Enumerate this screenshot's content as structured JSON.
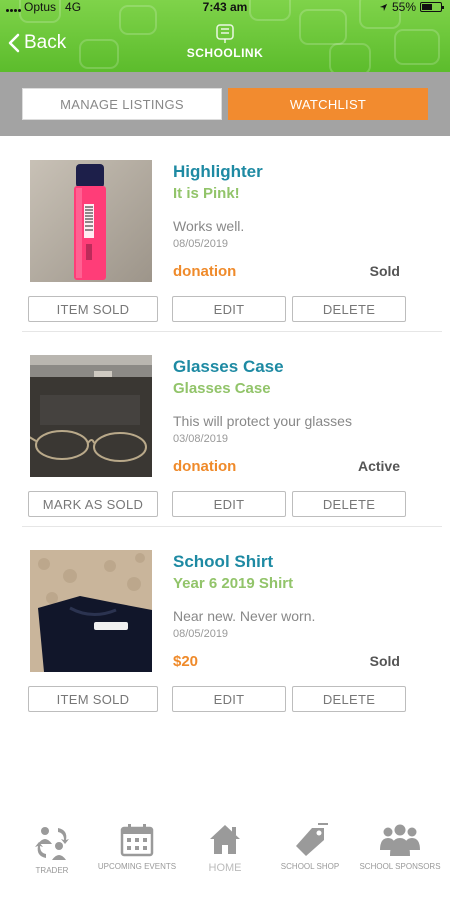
{
  "status_bar": {
    "carrier": "Optus",
    "network": "4G",
    "time": "7:43 am",
    "battery": "55%",
    "battery_level": 0.55
  },
  "header": {
    "back_label": "Back",
    "brand": "SCHOOLINK",
    "background_color": "#6cc63b"
  },
  "tabs": [
    {
      "label": "MANAGE LISTINGS",
      "active": false
    },
    {
      "label": "WATCHLIST",
      "active": true,
      "color": "#f28b2f"
    }
  ],
  "listings": [
    {
      "title": "Highlighter",
      "subtitle": "It is Pink!",
      "description": "Works well.",
      "date": "08/05/2019",
      "price": "donation",
      "status": "Sold",
      "primary_action": "ITEM SOLD",
      "edit_label": "EDIT",
      "delete_label": "DELETE",
      "image": "pink-highlighter-photo"
    },
    {
      "title": "Glasses Case",
      "subtitle": "Glasses Case",
      "description": "This will protect your glasses",
      "date": "03/08/2019",
      "price": "donation",
      "status": "Active",
      "primary_action": "MARK AS SOLD",
      "edit_label": "EDIT",
      "delete_label": "DELETE",
      "image": "glasses-case-photo"
    },
    {
      "title": "School Shirt",
      "subtitle": "Year 6 2019 Shirt",
      "description": "Near new. Never worn.",
      "date": "08/05/2019",
      "price": "$20",
      "status": "Sold",
      "primary_action": "ITEM SOLD",
      "edit_label": "EDIT",
      "delete_label": "DELETE",
      "image": "school-shirt-photo"
    }
  ],
  "bottom_nav": [
    {
      "label": "TRADER",
      "icon": "trader-icon"
    },
    {
      "label": "UPCOMING EVENTS",
      "icon": "calendar-icon"
    },
    {
      "label": "HOME",
      "icon": "home-icon"
    },
    {
      "label": "SCHOOL SHOP",
      "icon": "tag-icon"
    },
    {
      "label": "SCHOOL SPONSORS",
      "icon": "group-icon"
    }
  ],
  "colors": {
    "title": "#1e8aa3",
    "subtitle": "#92c46a",
    "price": "#ef8a2a",
    "tab_bar": "#a3a3a3"
  }
}
